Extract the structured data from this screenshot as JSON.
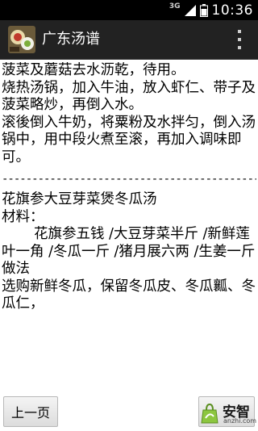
{
  "status_bar": {
    "network": "3G",
    "time": "10:36"
  },
  "app_bar": {
    "title": "广东汤谱",
    "icon": "app-food-icon",
    "menu_icon": "overflow-menu-icon"
  },
  "content": {
    "recipe1_lines": [
      "菠菜及蘑菇去水沥乾，待用。",
      "烧热汤锅，加入牛油，放入虾仁、带子及菠菜略炒，再倒入水。",
      "滚後倒入牛奶，将粟粉及水拌匀，倒入汤锅中，用中段火煮至滚，再加入调味即可。"
    ],
    "divider": "-----------------------------------------------------------",
    "recipe2": {
      "title": "花旗参大豆芽菜煲冬瓜汤",
      "ingredients_label": "材料：",
      "ingredients": "花旗参五钱 /大豆芽菜半斤 /新鲜莲叶一角 /冬瓜一斤 /猪月展六两 /生姜一斤",
      "method_label": "做法",
      "method": "选购新鲜冬瓜，保留冬瓜皮、冬瓜瓤、冬瓜仁，"
    }
  },
  "buttons": {
    "prev": "上一页"
  },
  "watermark": {
    "logo_text": "安智",
    "site": "anzhi.com"
  }
}
